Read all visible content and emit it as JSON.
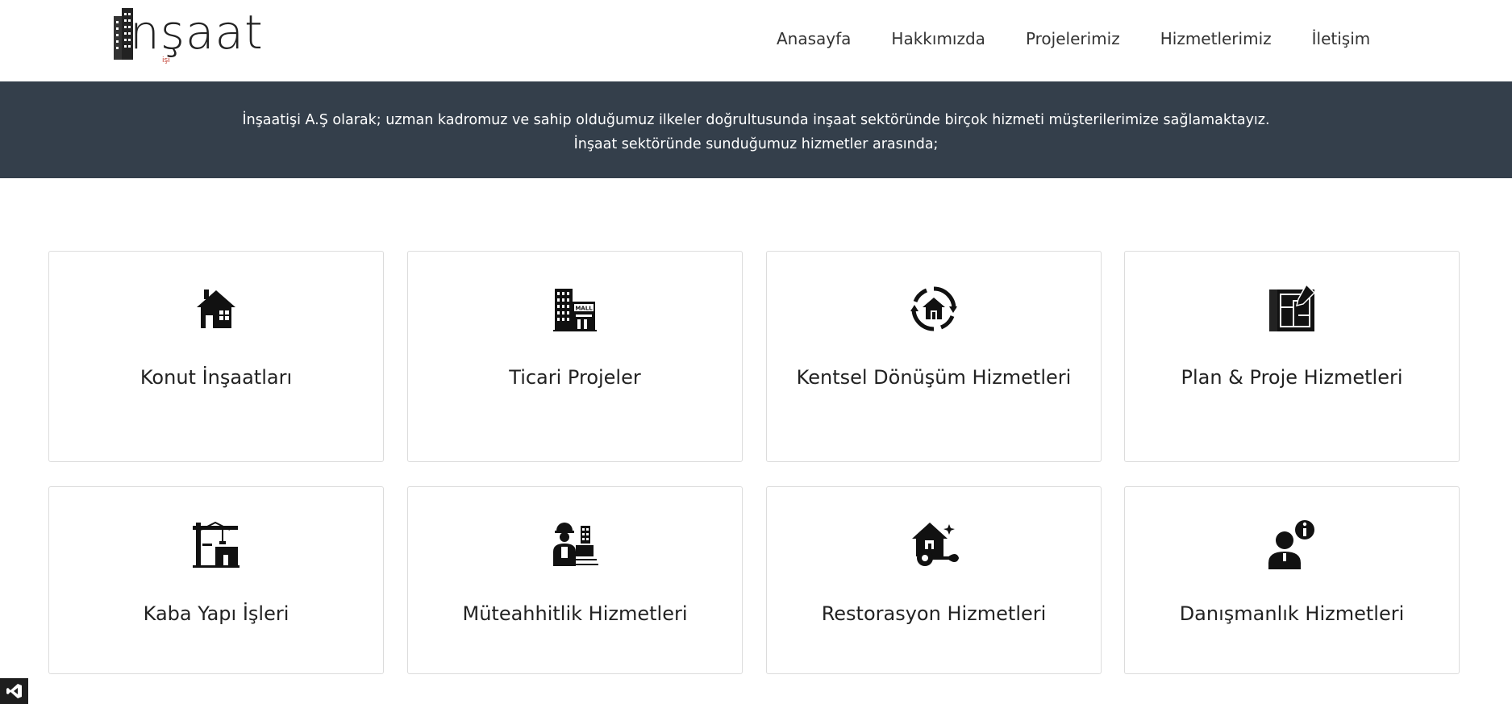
{
  "brand": {
    "logo_text": "nşaat",
    "logo_sub": "işi"
  },
  "nav": {
    "items": [
      "Anasayfa",
      "Hakkımızda",
      "Projelerimiz",
      "Hizmetlerimiz",
      "İletişim"
    ]
  },
  "banner": {
    "line1": "İnşaatişi A.Ş olarak; uzman kadromuz ve sahip olduğumuz ilkeler doğrultusunda inşaat sektöründe birçok hizmeti müşterilerimize sağlamaktayız.",
    "line2": "İnşaat sektöründe sunduğumuz hizmetler arasında;"
  },
  "services": [
    {
      "title": "Konut İnşaatları",
      "icon": "house-icon"
    },
    {
      "title": "Ticari Projeler",
      "icon": "mall-building-icon"
    },
    {
      "title": "Kentsel Dönüşüm Hizmetleri",
      "icon": "urban-renewal-icon"
    },
    {
      "title": "Plan & Proje Hizmetleri",
      "icon": "blueprint-icon"
    },
    {
      "title": "Kaba Yapı İşleri",
      "icon": "crane-icon"
    },
    {
      "title": "Müteahhitlik Hizmetleri",
      "icon": "contractor-icon"
    },
    {
      "title": "Restorasyon Hizmetleri",
      "icon": "house-repair-icon"
    },
    {
      "title": "Danışmanlık Hizmetleri",
      "icon": "consultant-icon"
    }
  ],
  "colors": {
    "banner_bg": "#343f4b",
    "banner_text": "#ffffff",
    "card_border": "#dcdcdc",
    "icon": "#111111"
  }
}
